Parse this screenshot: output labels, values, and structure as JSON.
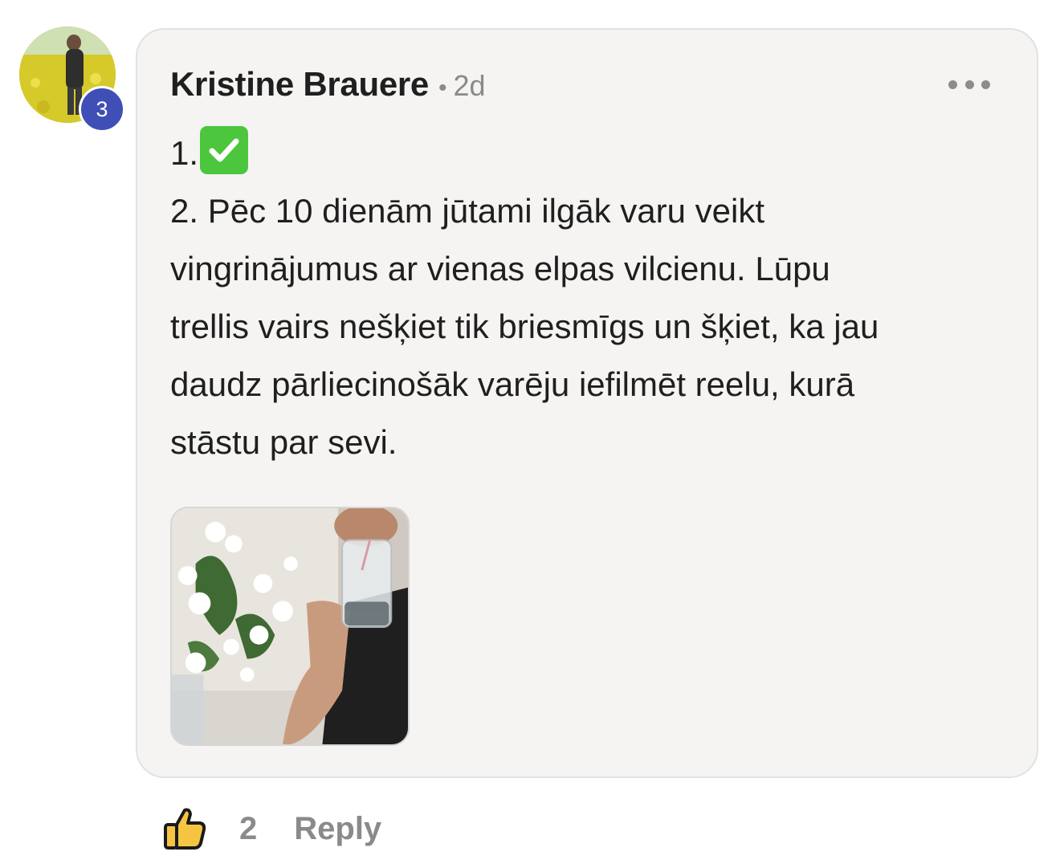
{
  "comment": {
    "author": "Kristine Brauere",
    "separator": "•",
    "time": "2d",
    "level_badge": "3",
    "lines": [
      "1.",
      "2. Pēc 10 dienām jūtami ilgāk varu veikt",
      "vingrinājumus ar vienas elpas vilcienu. Lūpu",
      "trellis vairs nešķiet tik briesmīgs un šķiet, ka jau",
      "daudz pārliecinošāk varēju iefilmēt reelu, kurā",
      "stāstu par sevi."
    ],
    "check_emoji_color": "#4cc63c",
    "icons": {
      "more": "more-horizontal-icon",
      "like": "thumbs-up-icon",
      "check": "check-mark-icon"
    }
  },
  "footer": {
    "like_count": "2",
    "reply_label": "Reply"
  },
  "colors": {
    "bubble_bg": "#f5f4f2",
    "badge_bg": "#3f4fb5",
    "muted_text": "#8a8a8a"
  }
}
